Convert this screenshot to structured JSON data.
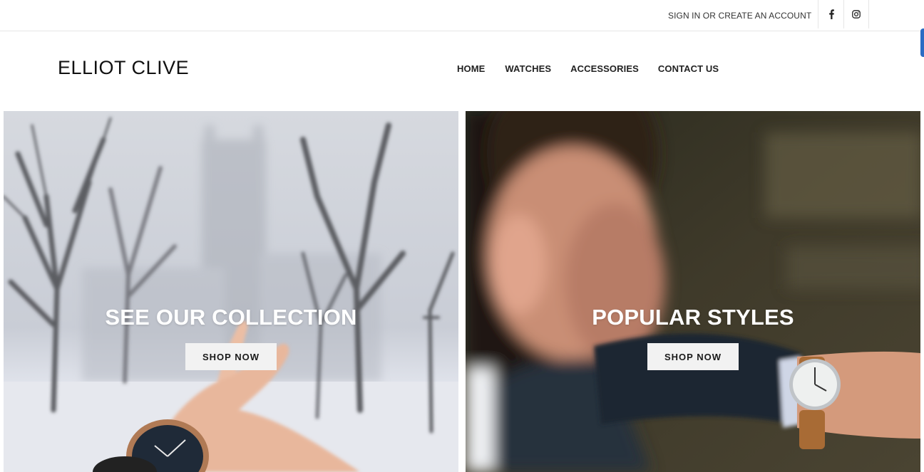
{
  "topbar": {
    "signin_text": "SIGN IN OR CREATE AN ACCOUNT",
    "social": [
      {
        "icon": "facebook-icon",
        "glyph": "f"
      },
      {
        "icon": "instagram-icon"
      }
    ]
  },
  "header": {
    "logo": "ELLIOT CLIVE",
    "nav": [
      {
        "label": "HOME"
      },
      {
        "label": "WATCHES"
      },
      {
        "label": "ACCESSORIES"
      },
      {
        "label": "CONTACT US"
      }
    ]
  },
  "hero": {
    "panels": [
      {
        "title": "SEE OUR COLLECTION",
        "button": "SHOP NOW",
        "scene": "snowy-trees-watch"
      },
      {
        "title": "POPULAR STYLES",
        "button": "SHOP NOW",
        "scene": "man-checking-watch"
      }
    ]
  },
  "colors": {
    "accent_tab": "#2a6cc4",
    "button_bg": "#f2f2f2",
    "text_dark": "#222222"
  }
}
